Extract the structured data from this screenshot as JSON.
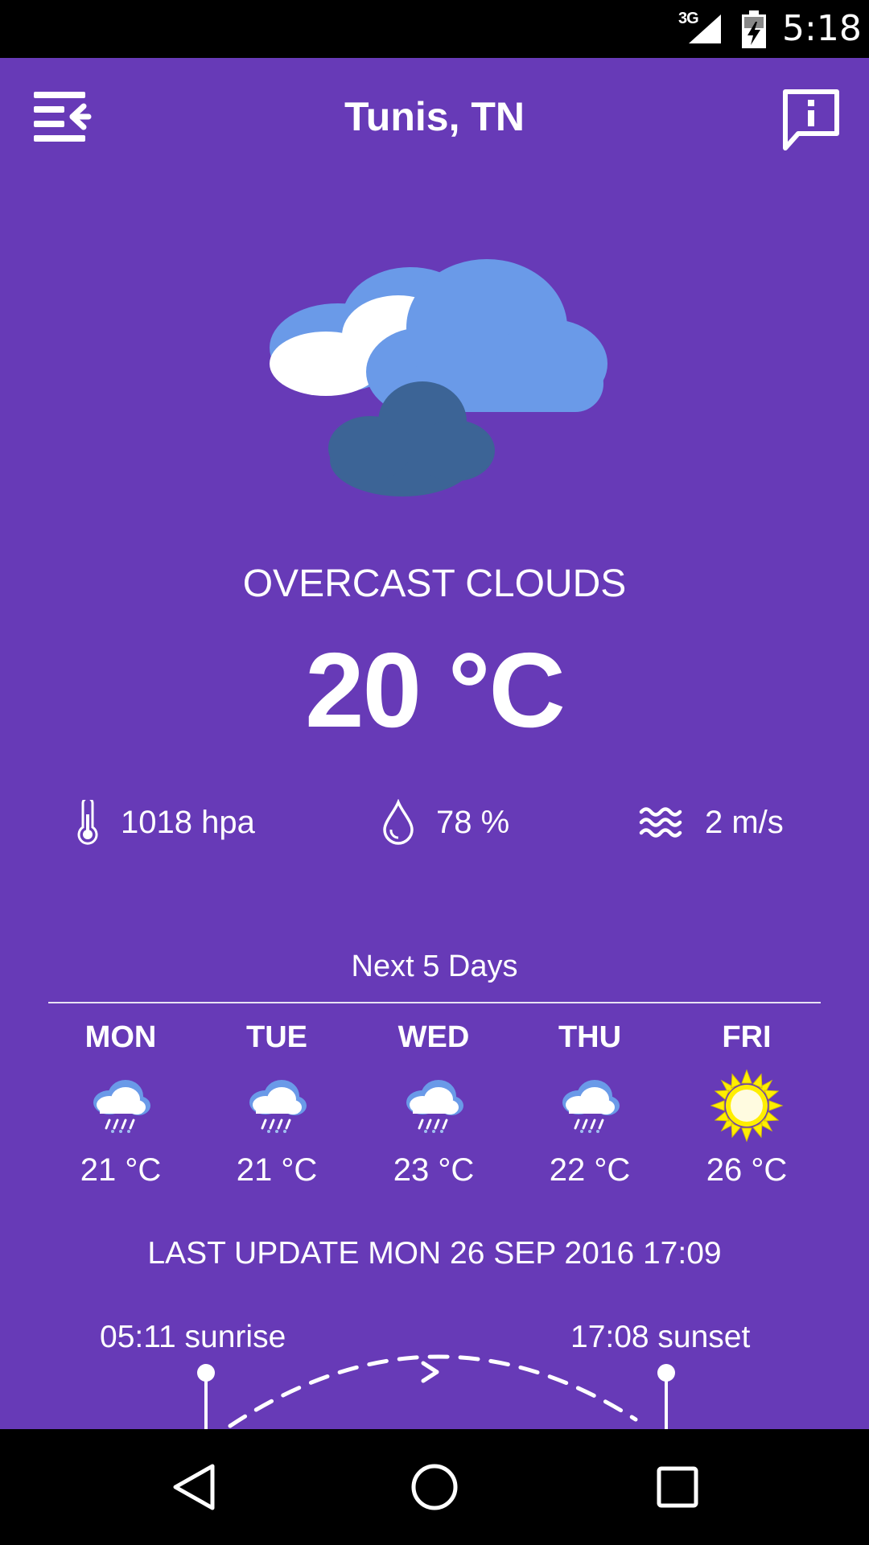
{
  "status_bar": {
    "network": "3G",
    "time": "5:18"
  },
  "header": {
    "city": "Tunis, TN",
    "menu_icon": "menu-collapse-icon",
    "info_icon": "info-message-icon"
  },
  "current": {
    "icon": "overcast-clouds-icon",
    "condition": "OVERCAST CLOUDS",
    "temperature": "20 °C",
    "pressure": "1018 hpa",
    "humidity": "78 %",
    "wind": "2 m/s"
  },
  "forecast": {
    "label": "Next 5 Days",
    "days": [
      {
        "day": "MON",
        "temp": "21 °C",
        "icon": "rain-cloud-icon"
      },
      {
        "day": "TUE",
        "temp": "21 °C",
        "icon": "rain-cloud-icon"
      },
      {
        "day": "WED",
        "temp": "23 °C",
        "icon": "rain-cloud-icon"
      },
      {
        "day": "THU",
        "temp": "22 °C",
        "icon": "rain-cloud-icon"
      },
      {
        "day": "FRI",
        "temp": "26 °C",
        "icon": "sun-icon"
      }
    ]
  },
  "last_update": "LAST UPDATE MON 26 SEP 2016 17:09",
  "sun": {
    "sunrise": "05:11 sunrise",
    "sunset": "17:08 sunset"
  },
  "colors": {
    "background": "#673ab7",
    "cloud_light": "#6a9ae8",
    "cloud_dark": "#3c6496",
    "sun": "#ffee00"
  }
}
